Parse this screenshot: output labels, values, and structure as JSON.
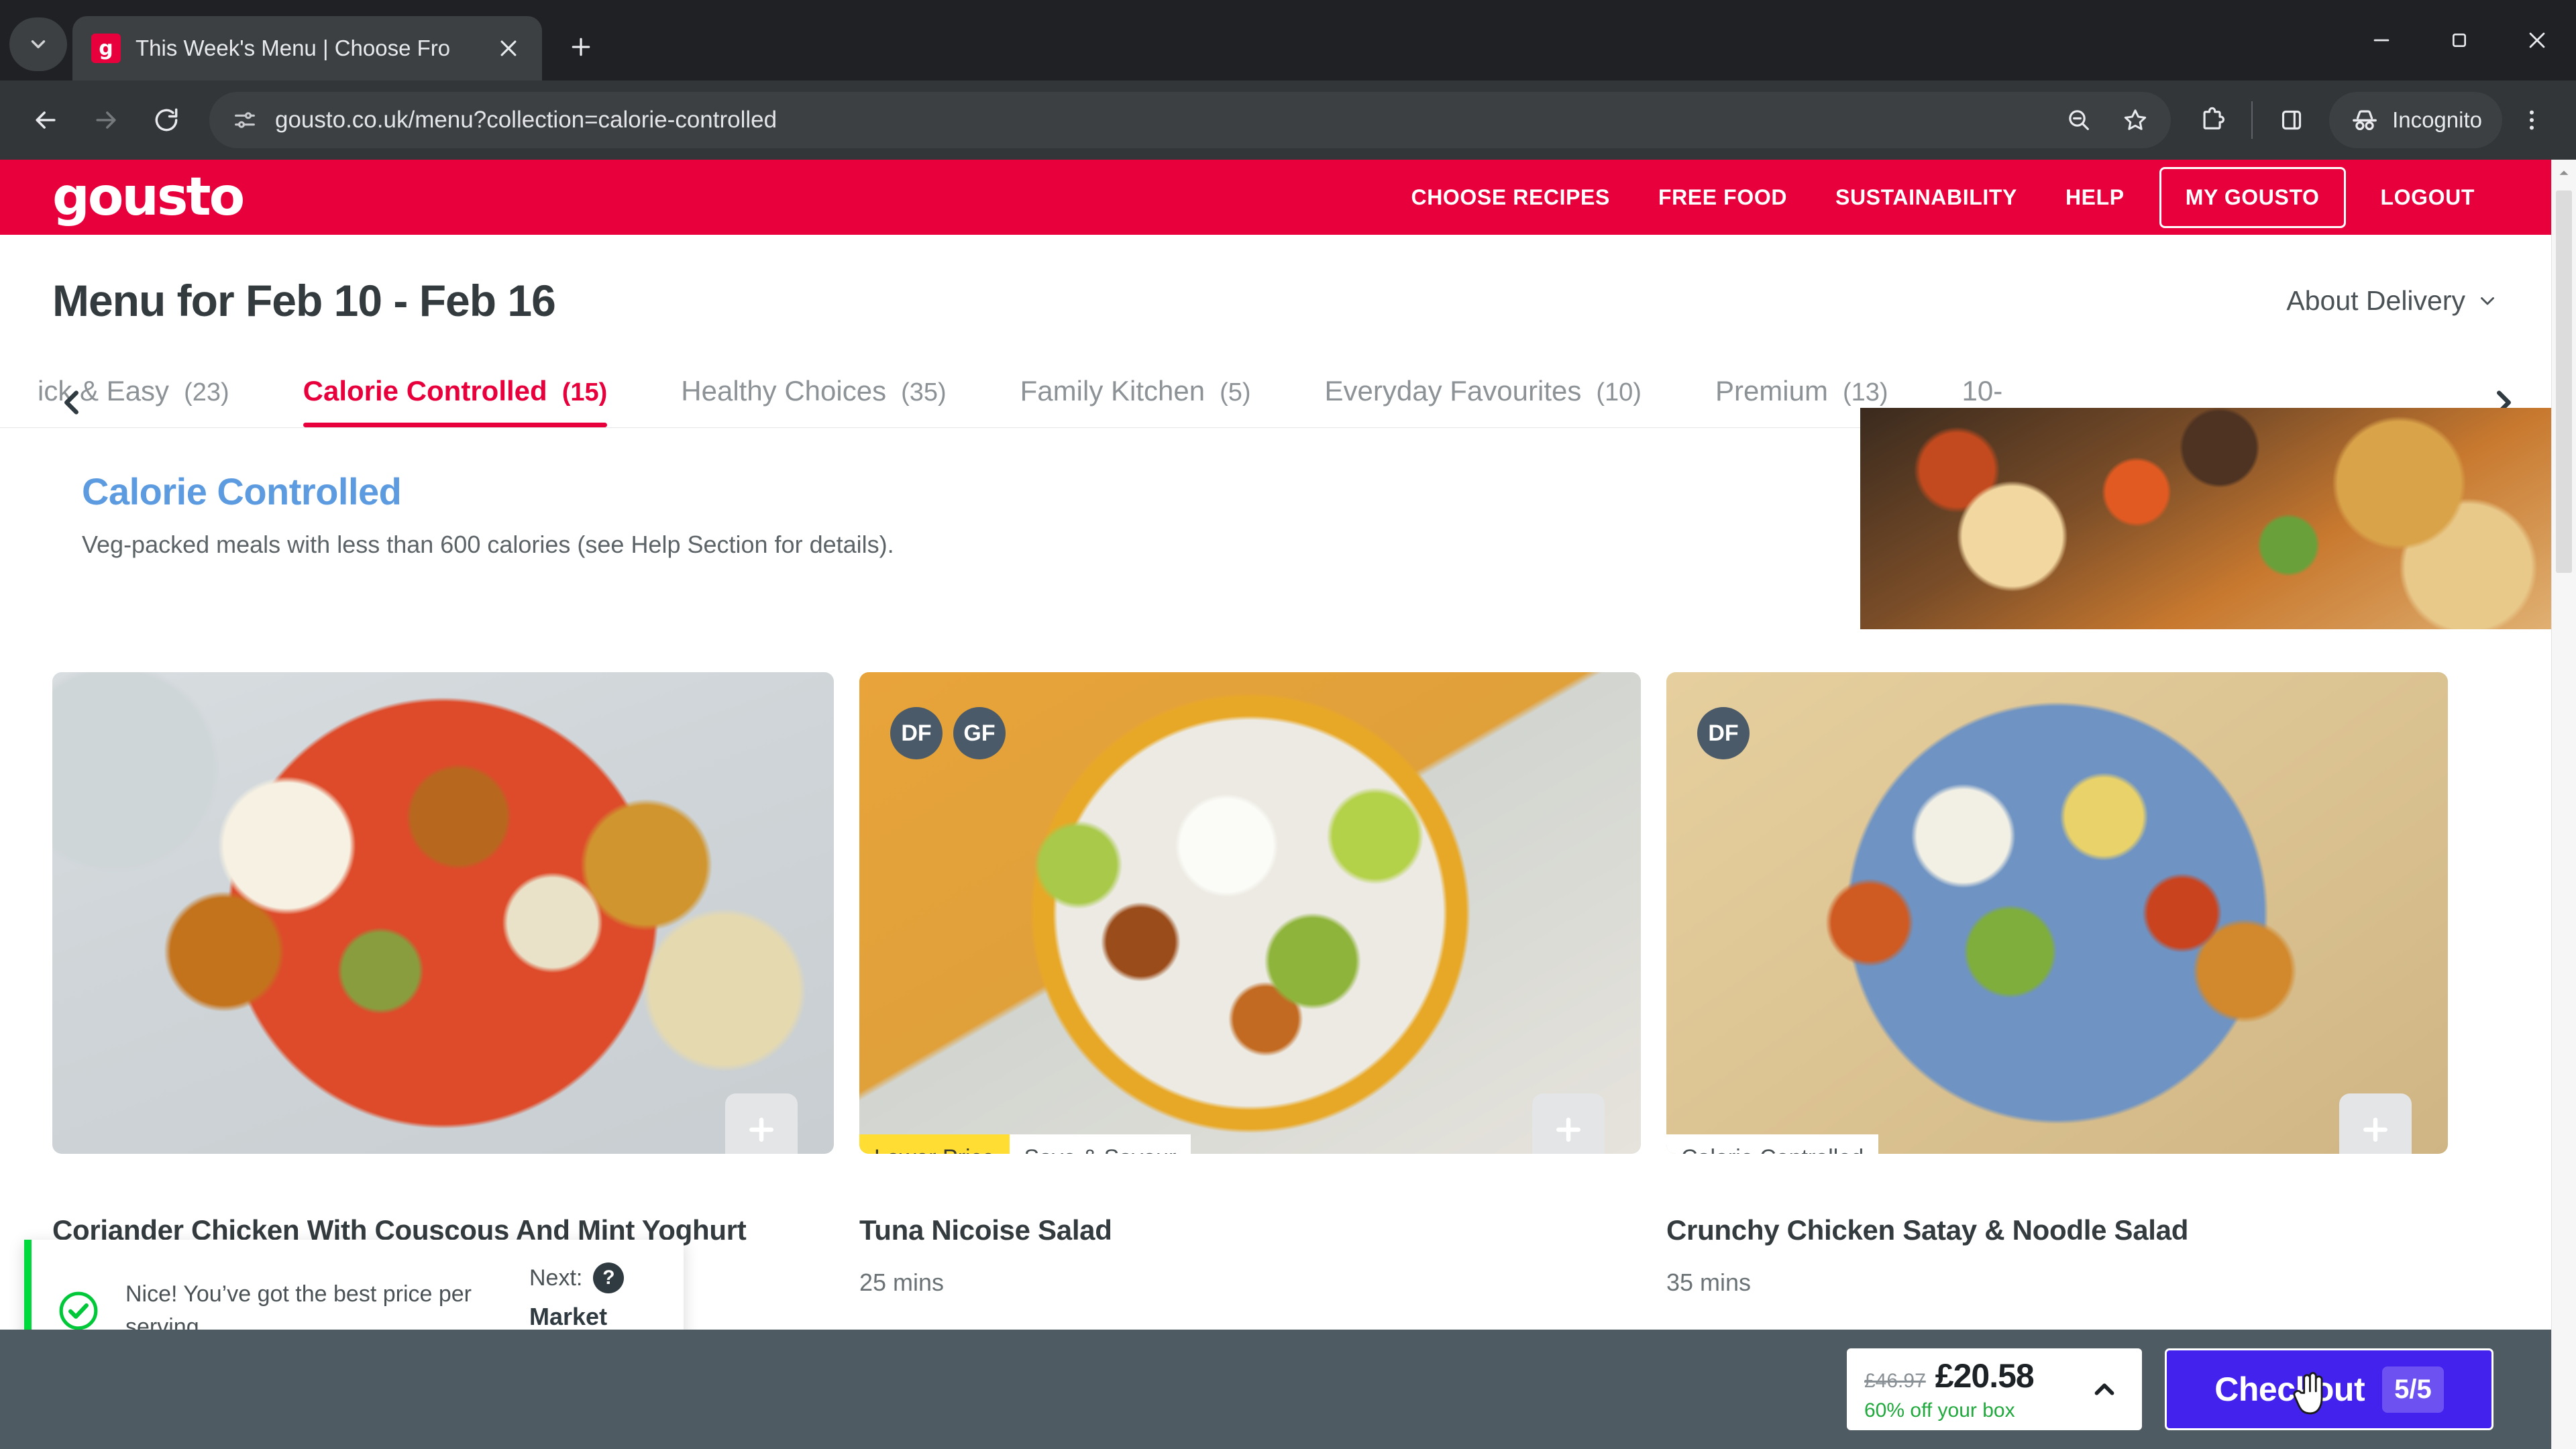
{
  "browser": {
    "tab": {
      "title": "This Week's Menu | Choose Fro",
      "favicon_letter": "g",
      "close_icon": "close-icon"
    },
    "new_tab_label": "+",
    "omnibox": {
      "url": "gousto.co.uk/menu?collection=calorie-controlled"
    },
    "profile_chip": "Incognito",
    "window": {
      "minimize": "–",
      "maximize": "❐",
      "close": "✕"
    }
  },
  "site_header": {
    "logo": "gousto",
    "nav": [
      {
        "label": "CHOOSE RECIPES",
        "boxed": false
      },
      {
        "label": "FREE FOOD",
        "boxed": false
      },
      {
        "label": "SUSTAINABILITY",
        "boxed": false
      },
      {
        "label": "HELP",
        "boxed": false
      },
      {
        "label": "MY GOUSTO",
        "boxed": true
      },
      {
        "label": "LOGOUT",
        "boxed": false
      }
    ],
    "brand_color": "#E8003C"
  },
  "menu": {
    "title": "Menu for Feb 10 - Feb 16",
    "about_delivery": "About Delivery",
    "tabs": [
      {
        "label": "ick & Easy",
        "count": "(23)",
        "active": false,
        "clipped": true
      },
      {
        "label": "Calorie Controlled",
        "count": "(15)",
        "active": true,
        "clipped": false
      },
      {
        "label": "Healthy Choices",
        "count": "(35)",
        "active": false,
        "clipped": false
      },
      {
        "label": "Family Kitchen",
        "count": "(5)",
        "active": false,
        "clipped": false
      },
      {
        "label": "Everyday Favourites",
        "count": "(10)",
        "active": false,
        "clipped": false
      },
      {
        "label": "Premium",
        "count": "(13)",
        "active": false,
        "clipped": false
      },
      {
        "label": "10-",
        "count": "",
        "active": false,
        "clipped": true
      }
    ],
    "tabs_prev_icon": "chevron-left-icon",
    "tabs_next_icon": "chevron-right-icon"
  },
  "collection": {
    "title": "Calorie Controlled",
    "subtitle": "Veg-packed meals with less than 600 calories (see Help Section for details).",
    "title_color": "#5C9BE0"
  },
  "recipes": [
    {
      "title": "Coriander Chicken With Couscous And Mint Yoghurt",
      "time": "",
      "diet_badges": [],
      "tags": []
    },
    {
      "title": "Tuna Nicoise Salad",
      "time": "25 mins",
      "diet_badges": [
        "DF",
        "GF"
      ],
      "tags": [
        {
          "label": "Lower Price",
          "style": "yellow"
        },
        {
          "label": "Save & Savour",
          "style": "white"
        }
      ]
    },
    {
      "title": "Crunchy Chicken Satay & Noodle Salad",
      "time": "35 mins",
      "diet_badges": [
        "DF"
      ],
      "tags": [
        {
          "label": "Calorie Controlled",
          "style": "white"
        }
      ]
    }
  ],
  "tooltip": {
    "message": "Nice! You’ve got the best price per serving",
    "next_label": "Next:",
    "next_value": "Market items",
    "check_icon": "check-circle-icon",
    "help_icon": "question-mark-icon",
    "accent_color": "#00D93B"
  },
  "checkout_bar": {
    "price_old": "£46.97",
    "price_new": "£20.58",
    "discount": "60% off your box",
    "expand_icon": "chevron-up-icon",
    "button_label": "Checkout",
    "button_count": "5/5",
    "button_color": "#4422EE"
  },
  "add_button_icon": "plus-icon"
}
